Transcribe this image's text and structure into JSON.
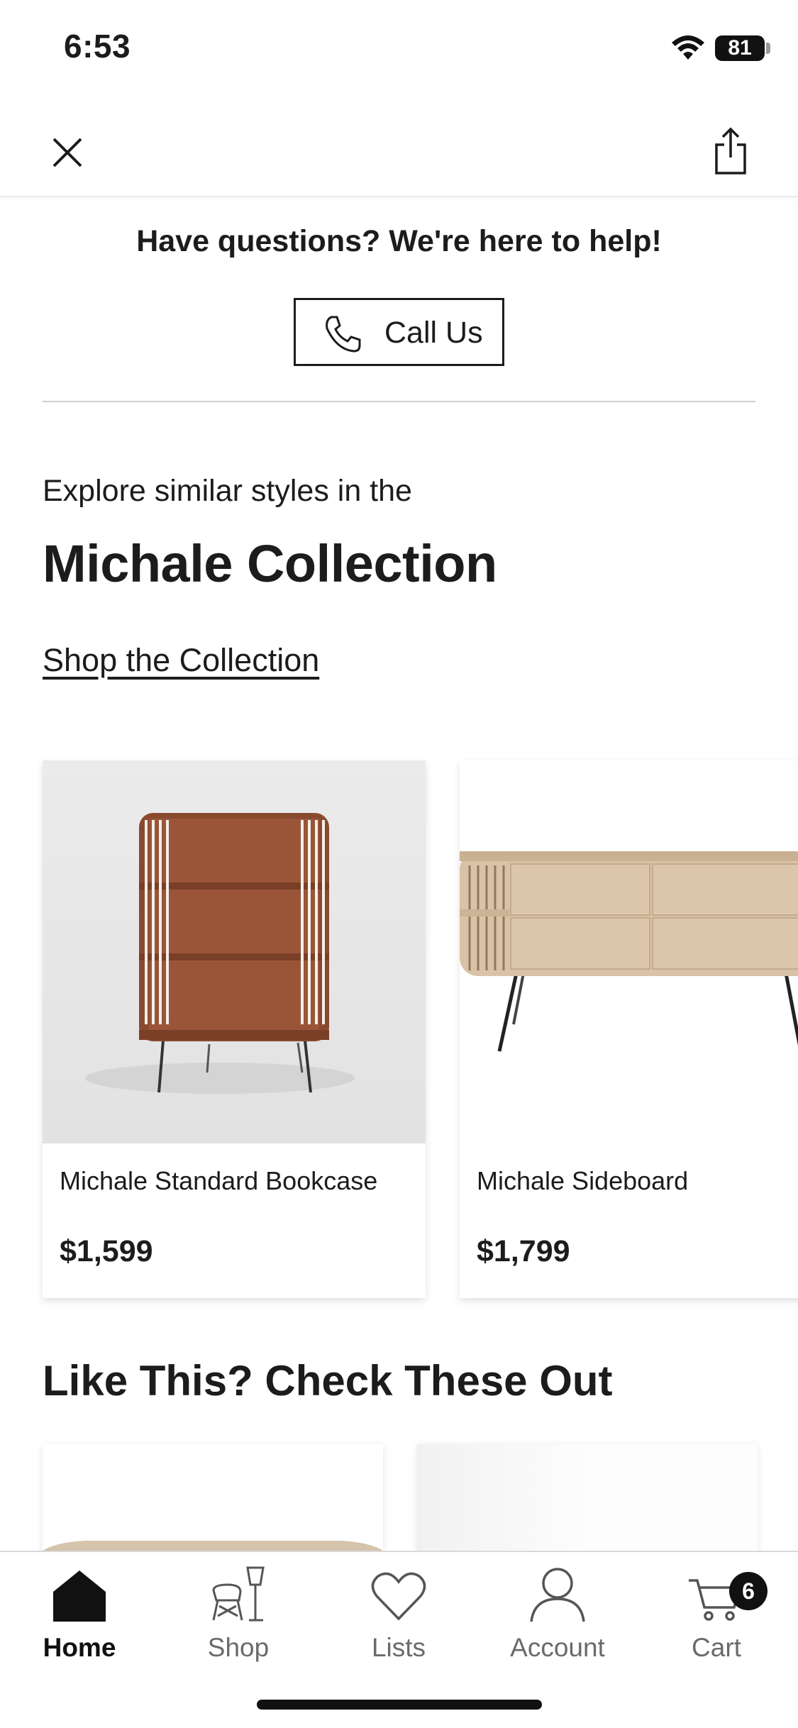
{
  "status_bar": {
    "time": "6:53",
    "battery": "81"
  },
  "help": {
    "title": "Have questions? We're here to help!",
    "call_label": "Call Us"
  },
  "collection": {
    "subtitle": "Explore similar styles in the",
    "title": "Michale Collection",
    "link": "Shop the Collection"
  },
  "products": [
    {
      "name": "Michale Standard Bookcase",
      "price": "$1,599"
    },
    {
      "name": "Michale Sideboard",
      "price": "$1,799"
    }
  ],
  "recommendations": {
    "title": "Like This? Check These Out"
  },
  "tab_bar": {
    "items": [
      {
        "label": "Home",
        "icon": "home-icon",
        "active": true
      },
      {
        "label": "Shop",
        "icon": "shop-icon",
        "active": false
      },
      {
        "label": "Lists",
        "icon": "heart-icon",
        "active": false
      },
      {
        "label": "Account",
        "icon": "account-icon",
        "active": false
      },
      {
        "label": "Cart",
        "icon": "cart-icon",
        "active": false
      }
    ],
    "cart_count": "6"
  },
  "colors": {
    "text": "#1c1c1c",
    "wood_walnut": "#8a4a30",
    "wood_light": "#d9c2a6"
  }
}
